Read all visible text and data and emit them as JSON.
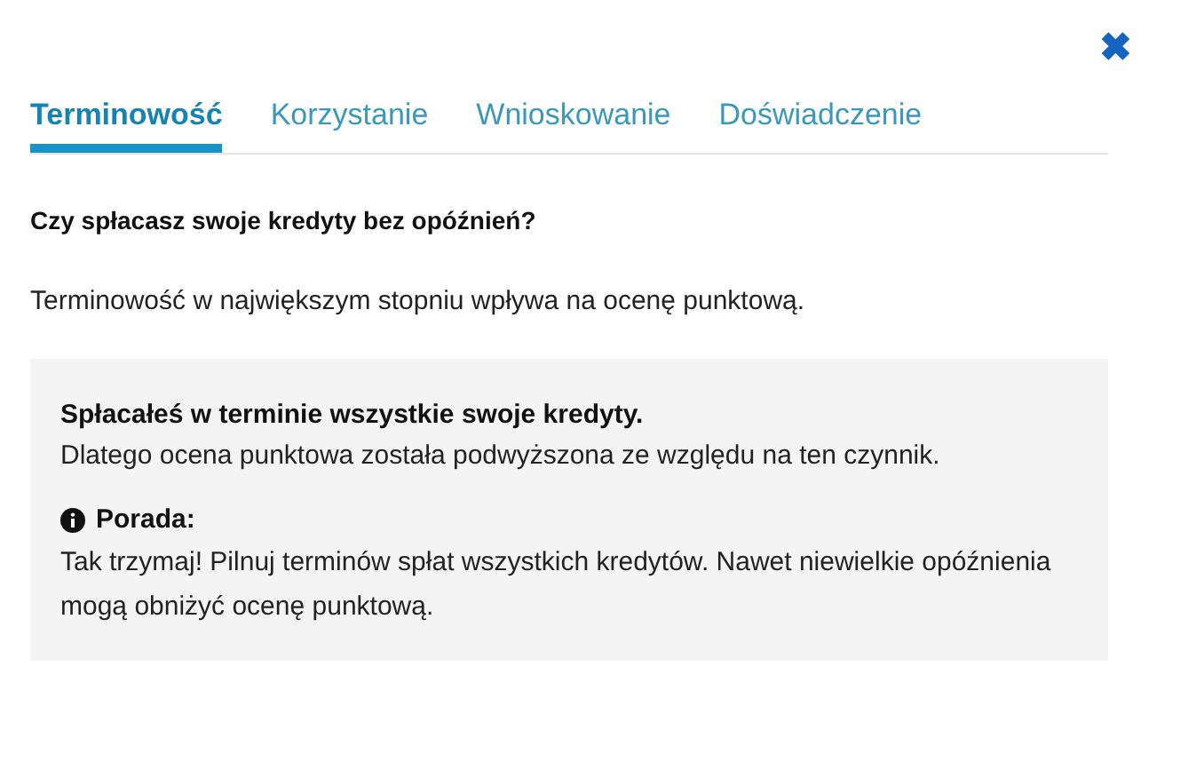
{
  "close": {
    "label": "✖"
  },
  "tabs": [
    {
      "label": "Terminowość",
      "selected": true
    },
    {
      "label": "Korzystanie",
      "selected": false
    },
    {
      "label": "Wnioskowanie",
      "selected": false
    },
    {
      "label": "Doświadczenie",
      "selected": false
    }
  ],
  "question": "Czy spłacasz swoje kredyty bez opóźnień?",
  "description": "Terminowość w największym stopniu wpływa na ocenę punktową.",
  "result": {
    "title": "Spłacałeś w terminie wszystkie swoje kredyty.",
    "text": "Dlatego ocena punktowa została podwyższona ze względu na ten czynnik."
  },
  "tip": {
    "label": "Porada:",
    "text": "Tak trzymaj! Pilnuj terminów spłat wszystkich kredytów. Nawet niewielkie opóźnienia mogą obniżyć ocenę punktową."
  }
}
